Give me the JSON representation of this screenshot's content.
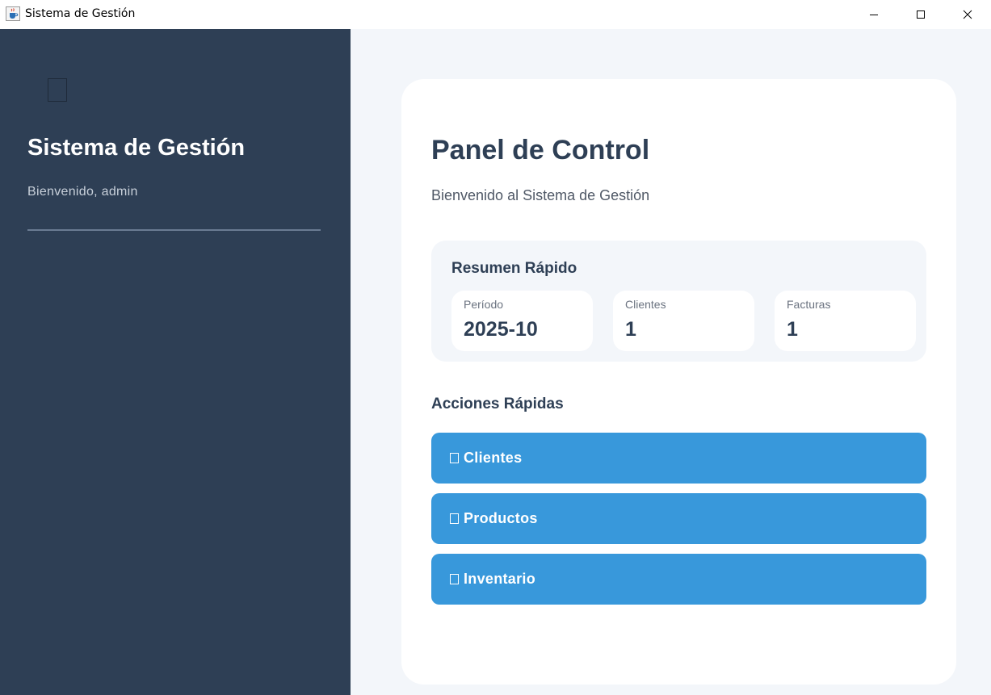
{
  "window": {
    "title": "Sistema de Gestión",
    "icon": "java-cup-icon"
  },
  "sidebar": {
    "title": "Sistema de Gestión",
    "welcome": "Bienvenido, admin",
    "background": "#2e3f55"
  },
  "main": {
    "title": "Panel de Control",
    "subtitle": "Bienvenido al Sistema de Gestión",
    "summary": {
      "title": "Resumen Rápido",
      "stats": [
        {
          "label": "Período",
          "value": "2025-10"
        },
        {
          "label": "Clientes",
          "value": "1"
        },
        {
          "label": "Facturas",
          "value": "1"
        }
      ]
    },
    "actions": {
      "title": "Acciones Rápidas",
      "buttons": [
        {
          "label": "Clientes",
          "icon": "missing-glyph-icon"
        },
        {
          "label": "Productos",
          "icon": "missing-glyph-icon"
        },
        {
          "label": "Inventario",
          "icon": "missing-glyph-icon"
        }
      ]
    }
  },
  "colors": {
    "accent": "#3898db",
    "heading": "#2e3f55",
    "background": "#f3f6fa"
  }
}
